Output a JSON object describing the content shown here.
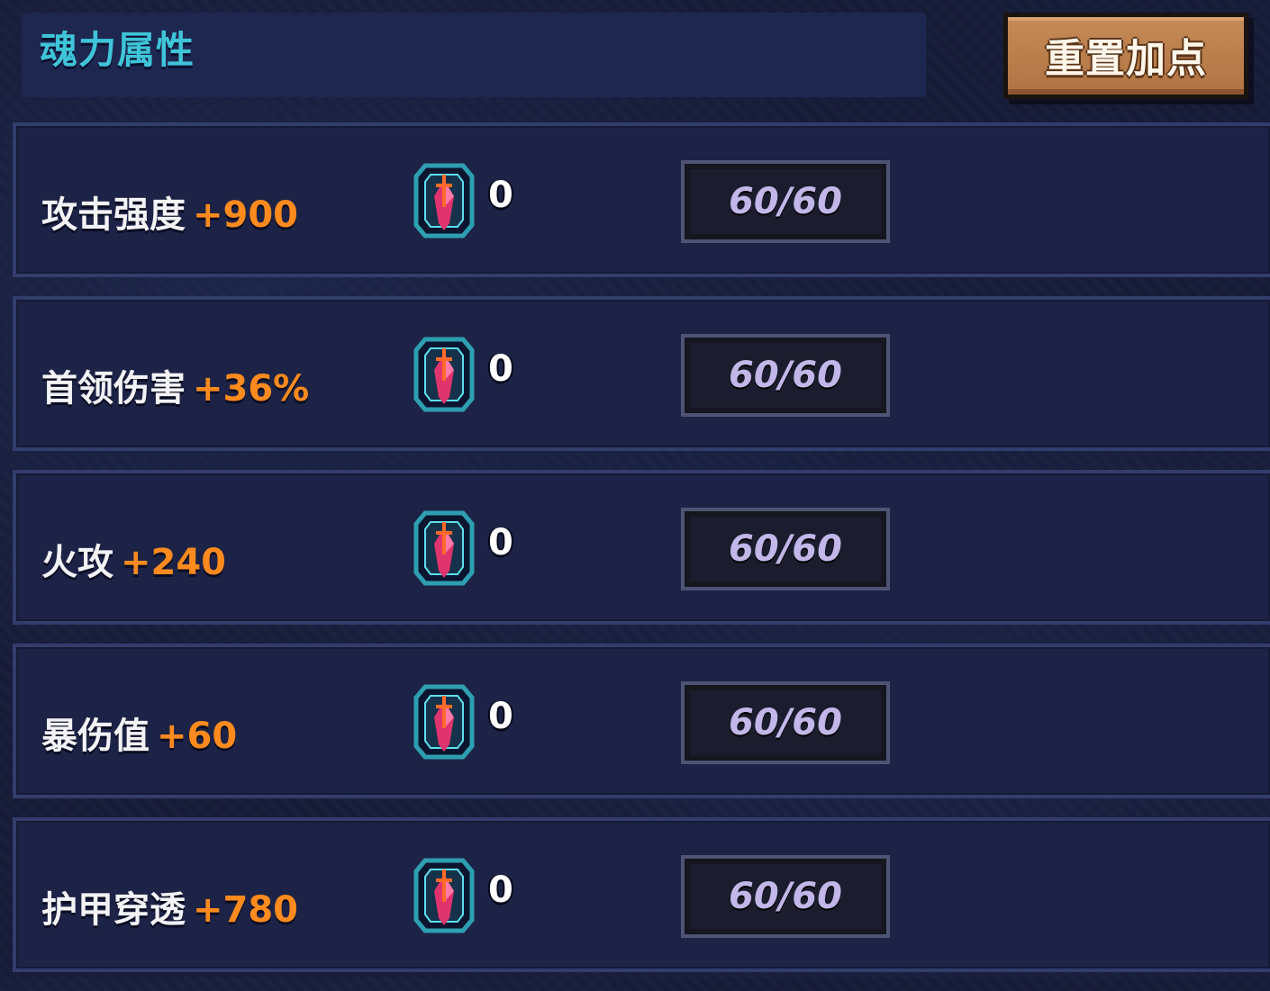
{
  "header": {
    "title": "魂力属性",
    "reset_button_label": "重置加点"
  },
  "stats": [
    {
      "name": "攻击强度",
      "bonus": "+900",
      "gem_count": "0",
      "level": "60/60"
    },
    {
      "name": "首领伤害",
      "bonus": "+36%",
      "gem_count": "0",
      "level": "60/60"
    },
    {
      "name": "火攻",
      "bonus": "+240",
      "gem_count": "0",
      "level": "60/60"
    },
    {
      "name": "暴伤值",
      "bonus": "+60",
      "gem_count": "0",
      "level": "60/60"
    },
    {
      "name": "护甲穿透",
      "bonus": "+780",
      "gem_count": "0",
      "level": "60/60"
    }
  ],
  "icons": {
    "gem": "soul-crystal-icon"
  },
  "colors": {
    "title": "#3fc4d8",
    "bonus": "#ff8a1e",
    "button": "#b27444",
    "level_text": "#c2b7e8"
  }
}
